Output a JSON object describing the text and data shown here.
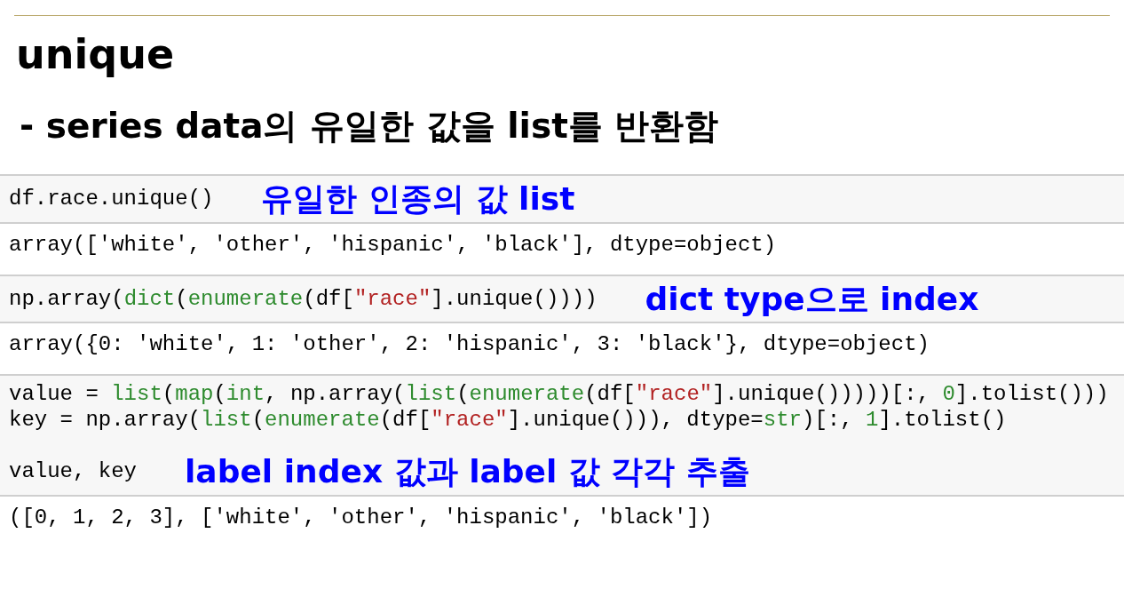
{
  "title": "unique",
  "subtitle": "- series data의 유일한 값을 list를 반환함",
  "cells": [
    {
      "input": [
        [
          {
            "tokens": [
              {
                "kind": "plain",
                "text": "df.race.unique()"
              }
            ],
            "annotation": "유일한 인종의 값 list"
          }
        ]
      ],
      "output": "array(['white', 'other', 'hispanic', 'black'], dtype=object)"
    },
    {
      "input": [
        [
          {
            "tokens": [
              {
                "kind": "plain",
                "text": "np.array("
              },
              {
                "kind": "builtin",
                "text": "dict"
              },
              {
                "kind": "plain",
                "text": "("
              },
              {
                "kind": "builtin",
                "text": "enumerate"
              },
              {
                "kind": "plain",
                "text": "(df["
              },
              {
                "kind": "string",
                "text": "\"race\""
              },
              {
                "kind": "plain",
                "text": "].unique())))"
              }
            ],
            "annotation": "dict type으로 index"
          }
        ]
      ],
      "output": "array({0: 'white', 1: 'other', 2: 'hispanic', 3: 'black'}, dtype=object)"
    },
    {
      "input": [
        [
          {
            "tokens": [
              {
                "kind": "plain",
                "text": "value = "
              },
              {
                "kind": "builtin",
                "text": "list"
              },
              {
                "kind": "plain",
                "text": "("
              },
              {
                "kind": "builtin",
                "text": "map"
              },
              {
                "kind": "plain",
                "text": "("
              },
              {
                "kind": "builtin",
                "text": "int"
              },
              {
                "kind": "plain",
                "text": ", np.array("
              },
              {
                "kind": "builtin",
                "text": "list"
              },
              {
                "kind": "plain",
                "text": "("
              },
              {
                "kind": "builtin",
                "text": "enumerate"
              },
              {
                "kind": "plain",
                "text": "(df["
              },
              {
                "kind": "string",
                "text": "\"race\""
              },
              {
                "kind": "plain",
                "text": "].unique()))))[:, "
              },
              {
                "kind": "number",
                "text": "0"
              },
              {
                "kind": "plain",
                "text": "].tolist()))"
              }
            ]
          },
          {
            "tokens": [
              {
                "kind": "plain",
                "text": "key = np.array("
              },
              {
                "kind": "builtin",
                "text": "list"
              },
              {
                "kind": "plain",
                "text": "("
              },
              {
                "kind": "builtin",
                "text": "enumerate"
              },
              {
                "kind": "plain",
                "text": "(df["
              },
              {
                "kind": "string",
                "text": "\"race\""
              },
              {
                "kind": "plain",
                "text": "].unique())), dtype="
              },
              {
                "kind": "builtin",
                "text": "str"
              },
              {
                "kind": "plain",
                "text": ")[:, "
              },
              {
                "kind": "number",
                "text": "1"
              },
              {
                "kind": "plain",
                "text": "].tolist()"
              }
            ]
          }
        ],
        [
          {
            "tokens": [
              {
                "kind": "plain",
                "text": "value, key"
              }
            ],
            "annotation": "label index 값과 label 값 각각 추출"
          }
        ]
      ],
      "output": "([0, 1, 2, 3], ['white', 'other', 'hispanic', 'black'])"
    }
  ]
}
